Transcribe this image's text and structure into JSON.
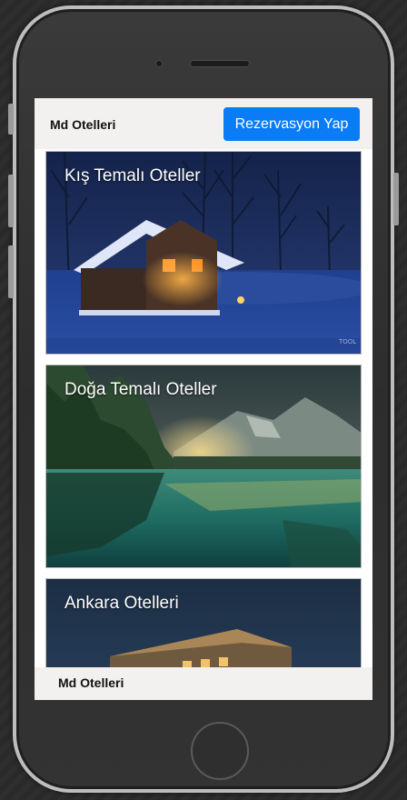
{
  "navbar": {
    "brand": "Md Otelleri",
    "cta_label": "Rezervasyon Yap"
  },
  "cards": [
    {
      "title": "Kış Temalı Oteller",
      "watermark": "TOOL"
    },
    {
      "title": "Doğa Temalı Oteller"
    },
    {
      "title": "Ankara Otelleri"
    }
  ],
  "footer": {
    "text": "Md Otelleri"
  },
  "colors": {
    "accent": "#0a7cf5",
    "bar_bg": "#f2f1ef"
  }
}
